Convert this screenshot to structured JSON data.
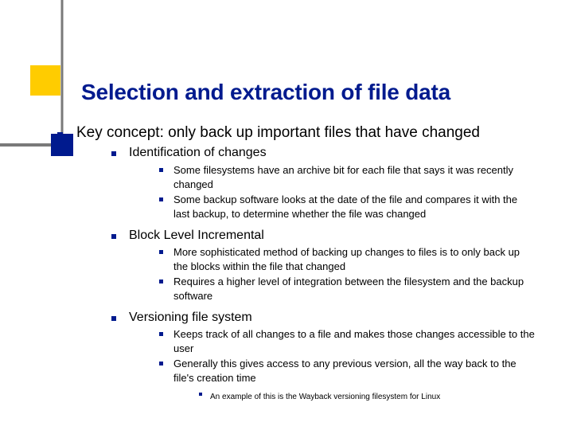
{
  "title": "Selection and extraction of file data",
  "lvl1": {
    "a": "Key concept: only back up important files that have changed"
  },
  "lvl2": {
    "a": "Identification of changes",
    "b": "Block Level Incremental",
    "c": "Versioning file system"
  },
  "lvl3": {
    "a1": "Some filesystems have an archive bit for each file that says it was recently changed",
    "a2": "Some backup software looks at the date of the file and compares it with the last backup, to determine whether the file was changed",
    "b1": "More sophisticated method of backing up changes to files is to only back up the blocks within the file that changed",
    "b2": "Requires a higher level of integration between the filesystem and the backup software",
    "c1": "Keeps track of all changes to a file and makes those changes accessible to the user",
    "c2": "Generally this gives access to any previous version, all the way back to the file's creation time"
  },
  "lvl4": {
    "c2a": "An example of this is the Wayback versioning filesystem for Linux"
  },
  "colors": {
    "accent": "#001a8e",
    "yellow": "#ffcc00",
    "grayline": "#7a7a7a"
  }
}
